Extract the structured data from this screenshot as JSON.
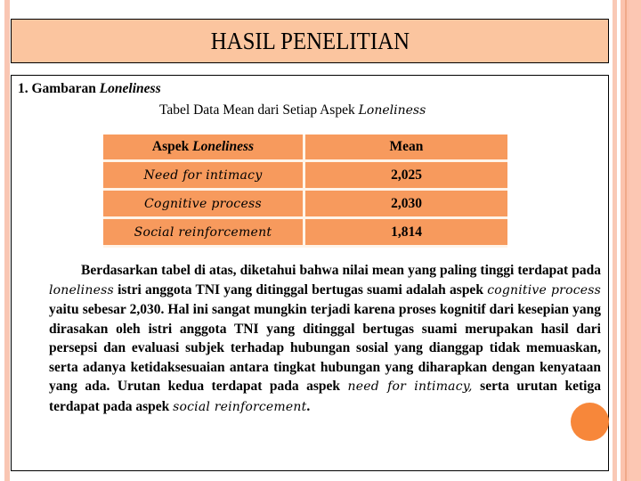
{
  "title": "HASIL PENELITIAN",
  "section": {
    "heading_prefix": "1. Gambaran ",
    "heading_italic": "Loneliness"
  },
  "table": {
    "caption_prefix": "Tabel Data Mean dari Setiap Aspek ",
    "caption_italic": "Loneliness",
    "headers": {
      "aspek_prefix": "Aspek ",
      "aspek_italic": "Loneliness",
      "mean": "Mean"
    },
    "rows": [
      {
        "aspek": "Need for intimacy",
        "mean": "2,025"
      },
      {
        "aspek": "Cognitive process",
        "mean": "2,030"
      },
      {
        "aspek": "Social reinforcement",
        "mean": "1,814"
      }
    ]
  },
  "paragraph": {
    "p1": "Berdasarkan tabel di atas, diketahui bahwa nilai mean yang paling tinggi terdapat pada ",
    "i1": "loneliness",
    "p2": " istri anggota TNI yang ditinggal bertugas suami adalah aspek ",
    "i2": "cognitive process",
    "p3": " yaitu sebesar 2,030. Hal ini sangat mungkin terjadi karena proses kognitif dari kesepian yang dirasakan oleh istri anggota TNI yang ditinggal bertugas suami merupakan hasil dari persepsi dan evaluasi subjek terhadap hubungan sosial yang dianggap tidak memuaskan, serta adanya ketidaksesuaian antara tingkat hubungan yang diharapkan dengan kenyataan yang ada. Urutan kedua terdapat pada aspek ",
    "i3": "need for intimacy,",
    "p4": " serta urutan ketiga terdapat pada aspek ",
    "i4": "social reinforcement",
    "p5": "."
  },
  "colors": {
    "title_bg": "#fbc59f",
    "table_bg": "#f79a5d",
    "accent_dot": "#f7873a",
    "stripe": "#f9c6b3"
  }
}
